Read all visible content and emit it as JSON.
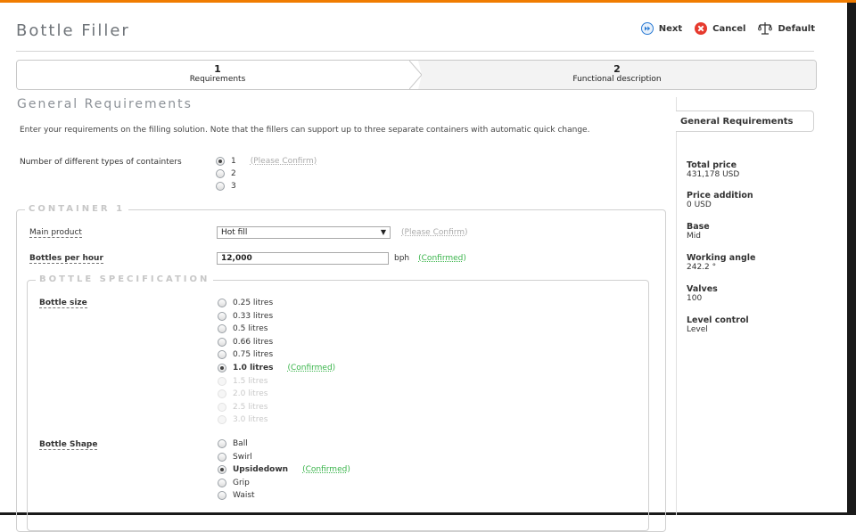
{
  "app": {
    "title": "Bottle Filler"
  },
  "toolbar": {
    "next_label": "Next",
    "cancel_label": "Cancel",
    "default_label": "Default"
  },
  "wizard": {
    "steps": [
      {
        "number": "1",
        "label": "Requirements"
      },
      {
        "number": "2",
        "label": "Functional description"
      }
    ]
  },
  "section": {
    "title": "General Requirements",
    "intro": "Enter your requirements on the filling solution. Note that the fillers can support up to three separate containers with automatic quick change."
  },
  "container_types": {
    "label": "Number of different types of containters",
    "options": [
      "1",
      "2",
      "3"
    ],
    "selected": "1",
    "status": "(Please Confirm)"
  },
  "container1": {
    "legend": "CONTAINER 1",
    "main_product": {
      "label": "Main product",
      "value": "Hot fill",
      "status": "(Please Confirm)"
    },
    "bottles_per_hour": {
      "label": "Bottles per hour",
      "value": "12,000",
      "unit": "bph",
      "status": "(Confirmed)"
    },
    "bottle_spec": {
      "legend": "BOTTLE SPECIFICATION",
      "size": {
        "label": "Bottle size",
        "options": [
          "0.25 litres",
          "0.33 litres",
          "0.5 litres",
          "0.66 litres",
          "0.75 litres",
          "1.0 litres",
          "1.5 litres",
          "2.0 litres",
          "2.5 litres",
          "3.0 litres"
        ],
        "selected": "1.0 litres",
        "status": "(Confirmed)"
      },
      "shape": {
        "label": "Bottle Shape",
        "options": [
          "Ball",
          "Swirl",
          "Upsidedown",
          "Grip",
          "Waist"
        ],
        "selected": "Upsidedown",
        "status": "(Confirmed)"
      }
    }
  },
  "sidebar": {
    "tab": "General Requirements",
    "items": [
      {
        "key": "Total price",
        "value": "431,178 USD"
      },
      {
        "key": "Price addition",
        "value": "0 USD"
      },
      {
        "key": "Base",
        "value": "Mid"
      },
      {
        "key": "Working angle",
        "value": "242.2 °"
      },
      {
        "key": "Valves",
        "value": "100"
      },
      {
        "key": "Level control",
        "value": "Level"
      }
    ]
  },
  "colors": {
    "accent": "#f07c00",
    "confirmed": "#39b44a",
    "next_icon": "#2a7bd4",
    "cancel_icon": "#e63a2e"
  },
  "icons": {
    "next": "next-icon",
    "cancel": "cancel-icon",
    "default": "balance-scale-icon"
  }
}
